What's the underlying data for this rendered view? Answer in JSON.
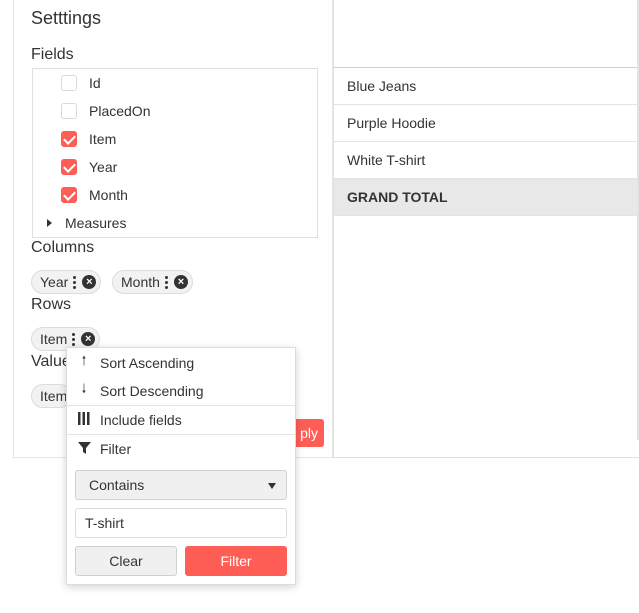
{
  "settings": {
    "title": "Setttings",
    "fields_label": "Fields",
    "fields": [
      {
        "label": "Id",
        "checked": false
      },
      {
        "label": "PlacedOn",
        "checked": false
      },
      {
        "label": "Item",
        "checked": true
      },
      {
        "label": "Year",
        "checked": true
      },
      {
        "label": "Month",
        "checked": true
      }
    ],
    "measures_label": "Measures",
    "columns_label": "Columns",
    "columns": [
      "Year",
      "Month"
    ],
    "rows_label": "Rows",
    "rows": [
      "Item"
    ],
    "values_label": "Value",
    "values": [
      "Item"
    ],
    "apply_label": "ply"
  },
  "grid": {
    "rows": [
      "Blue Jeans",
      "Purple Hoodie",
      "White T-shirt"
    ],
    "grand_total": "GRAND TOTAL"
  },
  "menu": {
    "sort_asc": "Sort Ascending",
    "sort_desc": "Sort Descending",
    "include_fields": "Include fields",
    "filter": "Filter",
    "condition": "Contains",
    "filter_value": "T-shirt",
    "clear_label": "Clear",
    "filter_button_label": "Filter"
  },
  "colors": {
    "accent": "#ff5e57"
  }
}
